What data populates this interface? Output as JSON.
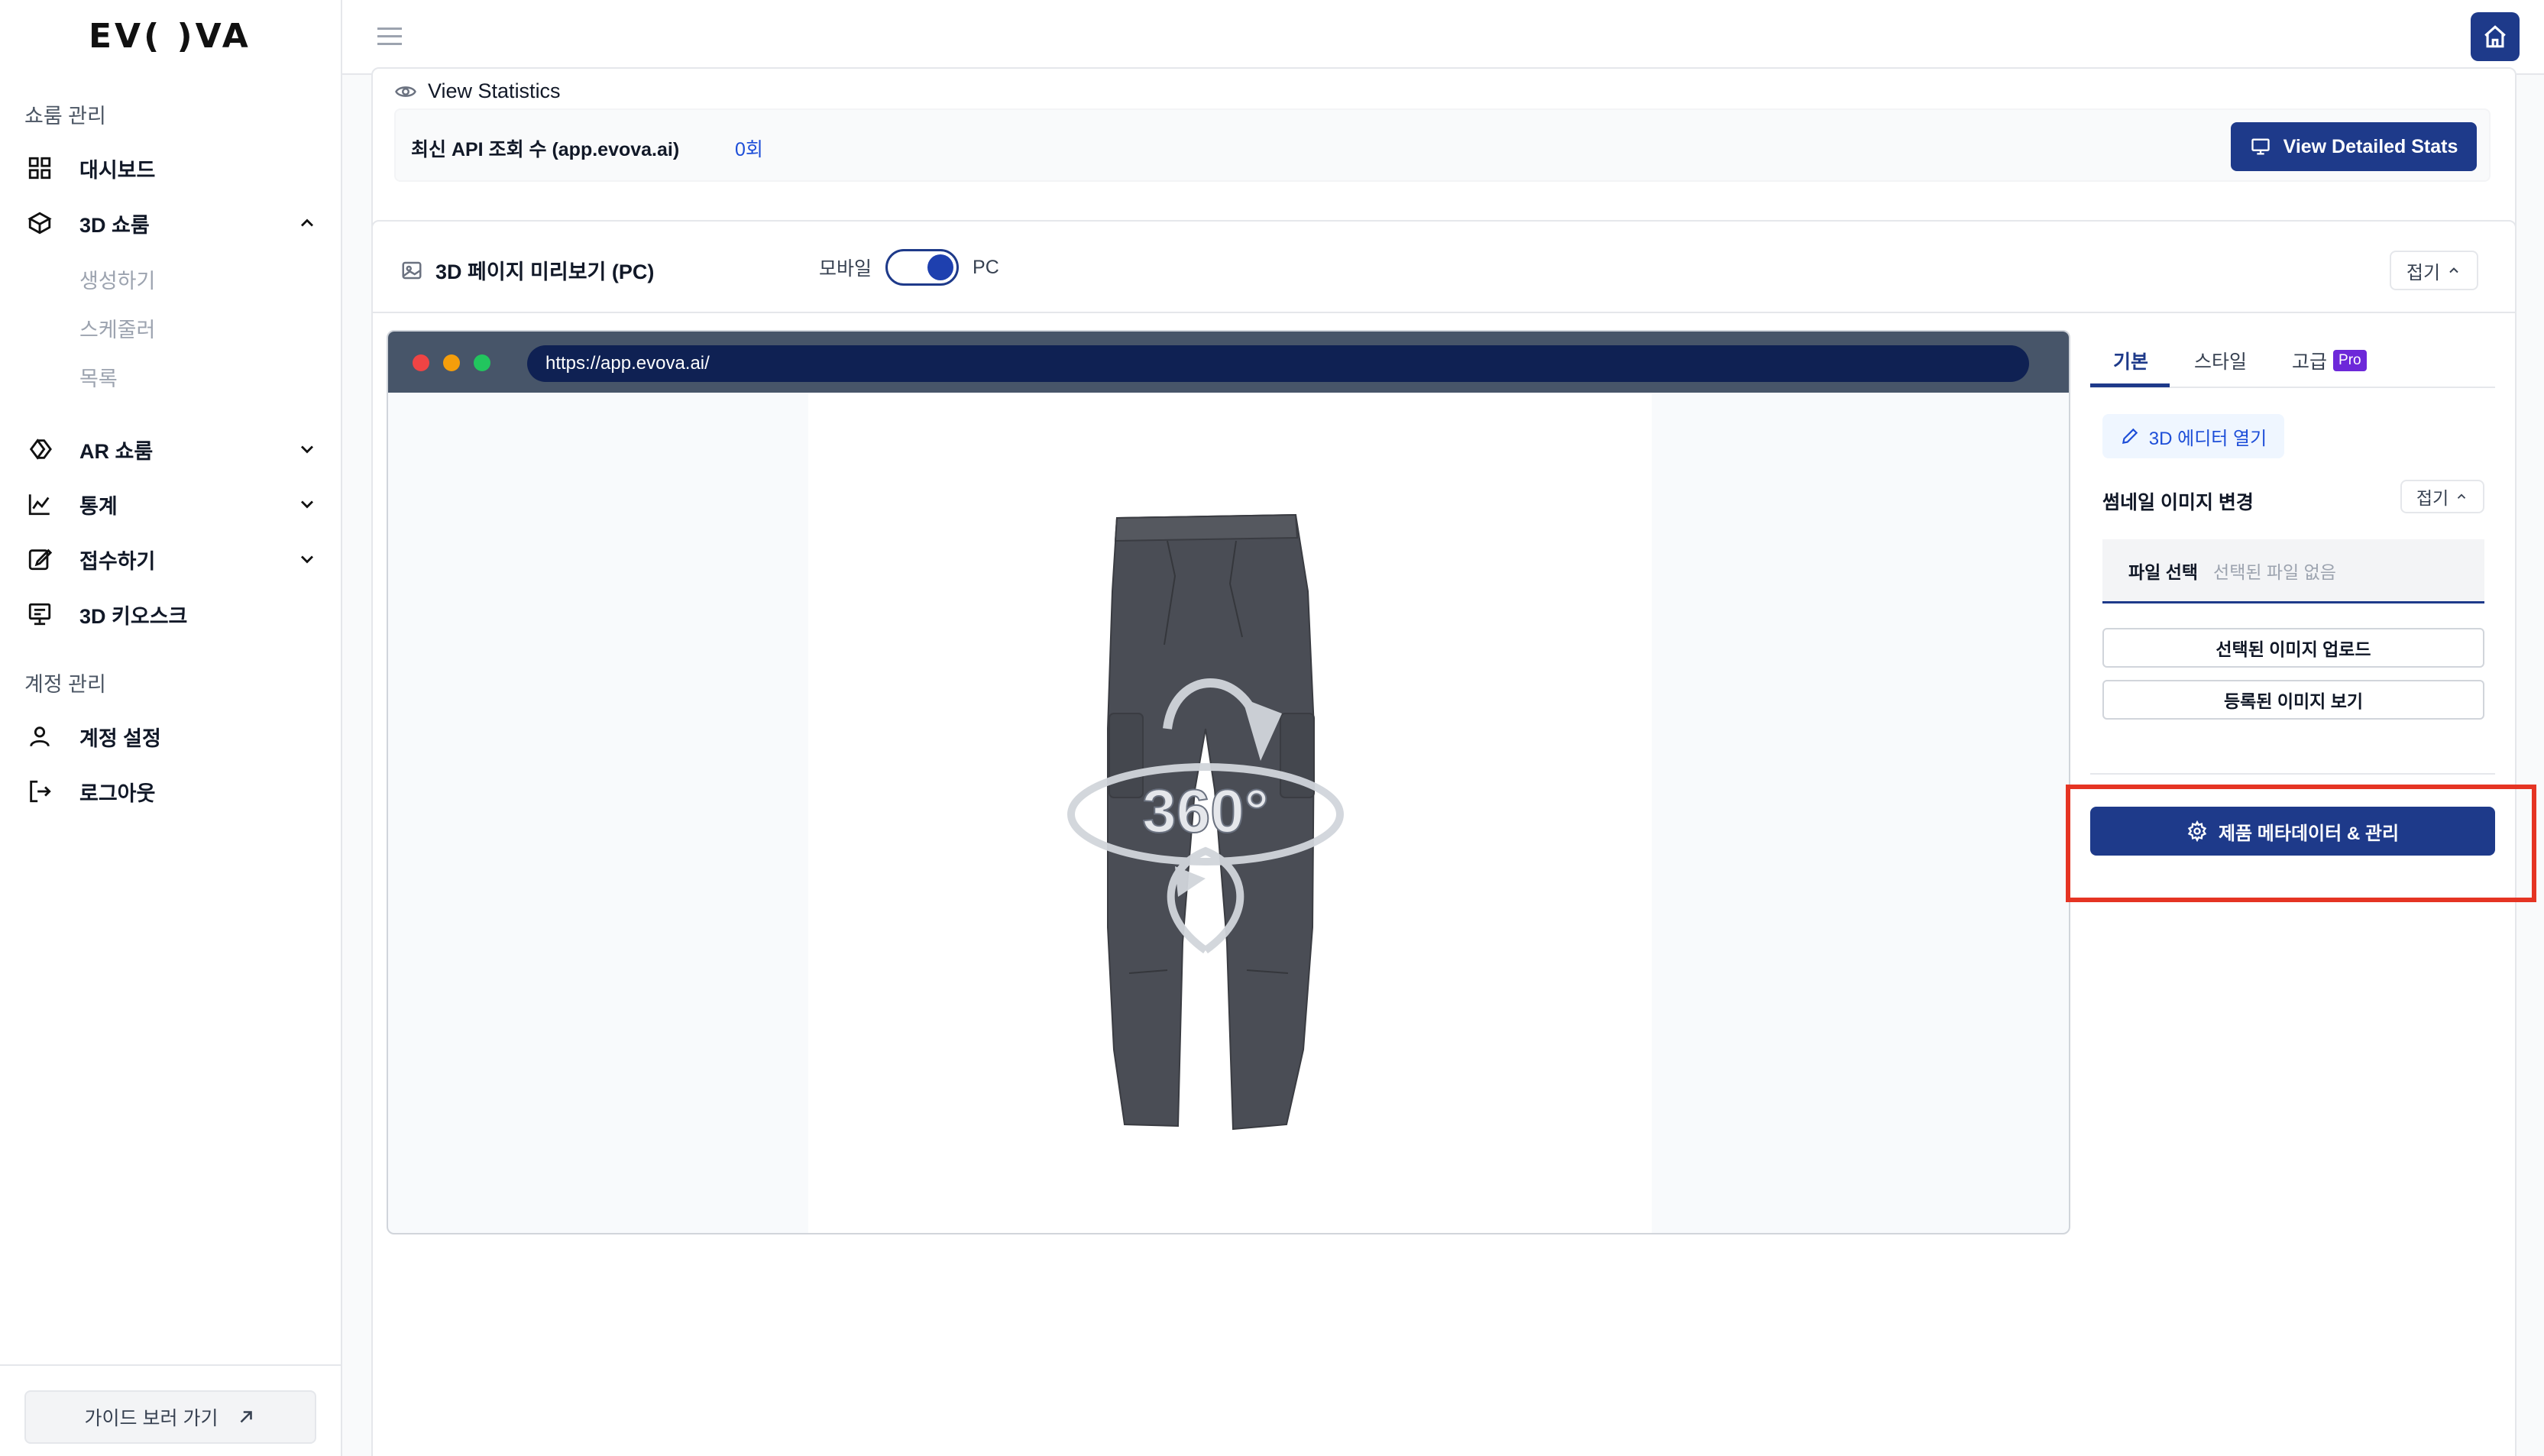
{
  "brand": {
    "logo_text": "EV( )VA"
  },
  "sidebar": {
    "section_showroom": "쇼룸 관리",
    "items": [
      {
        "label": "대시보드",
        "icon": "grid-icon"
      },
      {
        "label": "3D 쇼룸",
        "icon": "cube-icon",
        "expanded": true
      },
      {
        "label": "AR 쇼룸",
        "icon": "ar-icon"
      },
      {
        "label": "통계",
        "icon": "chart-icon"
      },
      {
        "label": "접수하기",
        "icon": "edit-icon"
      },
      {
        "label": "3D 키오스크",
        "icon": "kiosk-icon"
      }
    ],
    "sub_items": [
      "생성하기",
      "스케줄러",
      "목록"
    ],
    "section_account": "계정 관리",
    "account_items": [
      {
        "label": "계정 설정",
        "icon": "user-icon"
      },
      {
        "label": "로그아웃",
        "icon": "logout-icon"
      }
    ],
    "guide_button": "가이드 보러 가기"
  },
  "stats": {
    "title": "View Statistics",
    "label": "최신 API 조회 수 (app.evova.ai)",
    "value": "0회",
    "detail_button": "View Detailed Stats"
  },
  "preview": {
    "title": "3D 페이지 미리보기 (PC)",
    "toggle_left": "모바일",
    "toggle_right": "PC",
    "collapse_label": "접기",
    "url": "https://app.evova.ai/",
    "badge_360": "360°"
  },
  "panel": {
    "tabs": [
      {
        "label": "기본",
        "active": true
      },
      {
        "label": "스타일",
        "active": false
      },
      {
        "label": "고급",
        "active": false,
        "badge": "Pro"
      }
    ],
    "editor_button": "3D 에디터 열기",
    "thumb_title": "썸네일 이미지 변경",
    "thumb_collapse": "접기",
    "file_choose": "파일 선택",
    "file_none": "선택된 파일 없음",
    "upload_button": "선택된 이미지 업로드",
    "view_button": "등록된 이미지 보기",
    "meta_button": "제품 메타데이터 & 관리"
  },
  "colors": {
    "primary": "#1e3a8a",
    "highlight": "#e53423",
    "pro": "#6d28d9"
  }
}
